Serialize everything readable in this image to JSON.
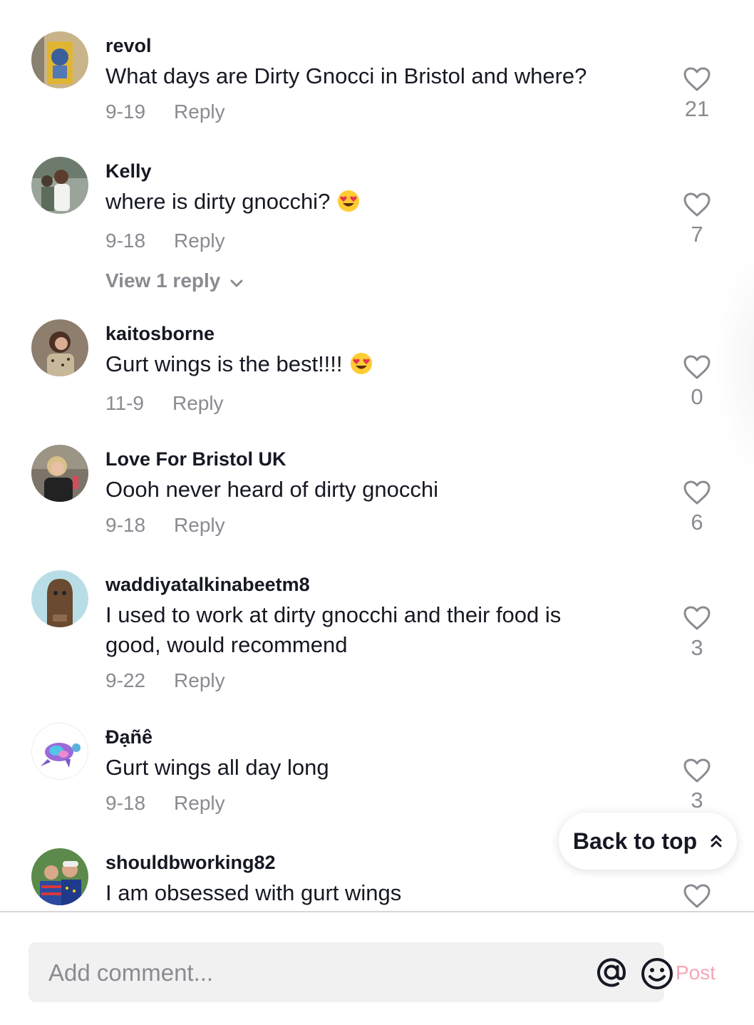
{
  "comments": [
    {
      "username": "revol",
      "text": "What days are Dirty Gnocci in Bristol and where?",
      "date": "9-19",
      "reply_label": "Reply",
      "likes": "21"
    },
    {
      "username": "Kelly",
      "text": "where is dirty gnocchi?",
      "date": "9-18",
      "reply_label": "Reply",
      "likes": "7",
      "view_replies": "View 1 reply"
    },
    {
      "username": "kaitosborne",
      "text": "Gurt wings is the best!!!!",
      "date": "11-9",
      "reply_label": "Reply",
      "likes": "0"
    },
    {
      "username": "Love For Bristol UK",
      "text": "Oooh never heard of dirty gnocchi",
      "date": "9-18",
      "reply_label": "Reply",
      "likes": "6"
    },
    {
      "username": "waddiyatalkinabeetm8",
      "text": "I used to work at dirty gnocchi and their food is good, would recommend",
      "date": "9-22",
      "reply_label": "Reply",
      "likes": "3"
    },
    {
      "username": "Đạñê",
      "text": "Gurt wings all day long",
      "date": "9-18",
      "reply_label": "Reply",
      "likes": "3"
    },
    {
      "username": "shouldbworking82",
      "text": "I am obsessed with gurt wings"
    }
  ],
  "back_to_top": {
    "label": "Back to top",
    "icon": "double-chevron-up-icon"
  },
  "composer": {
    "placeholder": "Add comment...",
    "post_label": "Post",
    "mention_icon": "at-sign-icon",
    "emoji_icon": "smiley-icon"
  },
  "colors": {
    "text": "#161823",
    "secondary": "#8a8b91",
    "post_disabled": "#f6a6b5",
    "input_bg": "#f1f1f2"
  }
}
